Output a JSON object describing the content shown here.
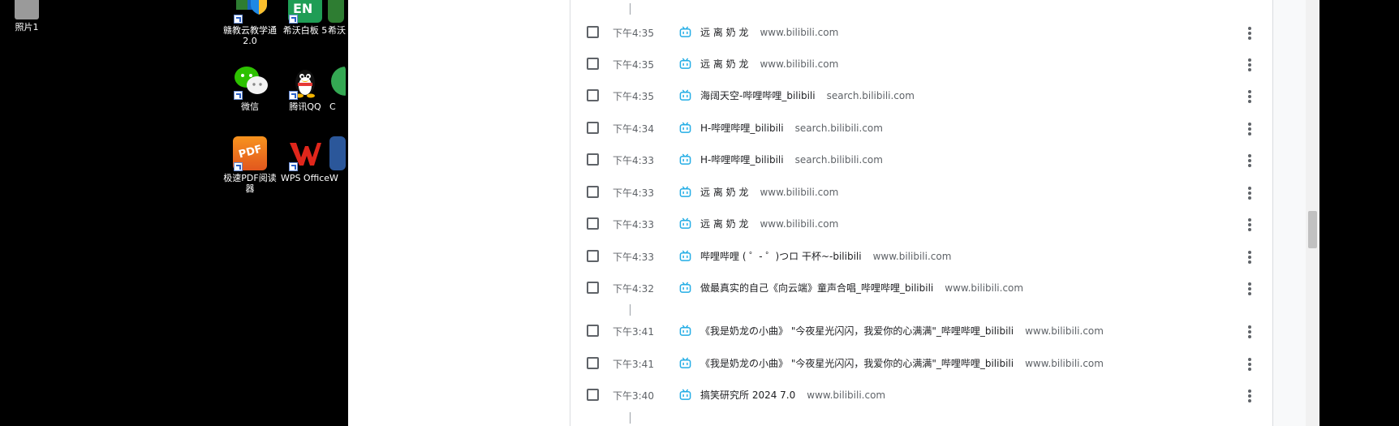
{
  "desktop": {
    "icons": [
      {
        "label": "照片1"
      },
      {
        "label": "赣教云教学通 2.0"
      },
      {
        "label": "希沃白板 5",
        "badge": "EN"
      },
      {
        "label": "希沃"
      },
      {
        "label": "微信"
      },
      {
        "label": "腾讯QQ"
      },
      {
        "label": "C"
      },
      {
        "label": "极速PDF阅读器",
        "badge": "PDF"
      },
      {
        "label": "WPS Office"
      },
      {
        "label": "W"
      }
    ]
  },
  "history": {
    "rows": [
      {
        "time": "下午4:35",
        "title": "远 离 奶 龙",
        "domain": "www.bilibili.com"
      },
      {
        "time": "下午4:35",
        "title": "远 离 奶 龙",
        "domain": "www.bilibili.com"
      },
      {
        "time": "下午4:35",
        "title": "海阔天空-哔哩哔哩_bilibili",
        "domain": "search.bilibili.com"
      },
      {
        "time": "下午4:34",
        "title": "H-哔哩哔哩_bilibili",
        "domain": "search.bilibili.com"
      },
      {
        "time": "下午4:33",
        "title": "H-哔哩哔哩_bilibili",
        "domain": "search.bilibili.com"
      },
      {
        "time": "下午4:33",
        "title": "远 离 奶 龙",
        "domain": "www.bilibili.com"
      },
      {
        "time": "下午4:33",
        "title": "远 离 奶 龙",
        "domain": "www.bilibili.com"
      },
      {
        "time": "下午4:33",
        "title": "哔哩哔哩 ( ゜- ゜)つロ 干杯~-bilibili",
        "domain": "www.bilibili.com"
      },
      {
        "time": "下午4:32",
        "title": "做最真实的自己《向云端》童声合唱_哔哩哔哩_bilibili",
        "domain": "www.bilibili.com"
      },
      {
        "time": "下午3:41",
        "title": "《我是奶龙の小曲》 \"今夜星光闪闪，我爱你的心满满\"_哔哩哔哩_bilibili",
        "domain": "www.bilibili.com"
      },
      {
        "time": "下午3:41",
        "title": "《我是奶龙の小曲》 \"今夜星光闪闪，我爱你的心满满\"_哔哩哔哩_bilibili",
        "domain": "www.bilibili.com"
      },
      {
        "time": "下午3:40",
        "title": "搞笑研究所 2024 7.0",
        "domain": "www.bilibili.com"
      }
    ]
  },
  "colors": {
    "favicon": "#23ade5",
    "text": "#202124",
    "muted": "#5f6368"
  }
}
